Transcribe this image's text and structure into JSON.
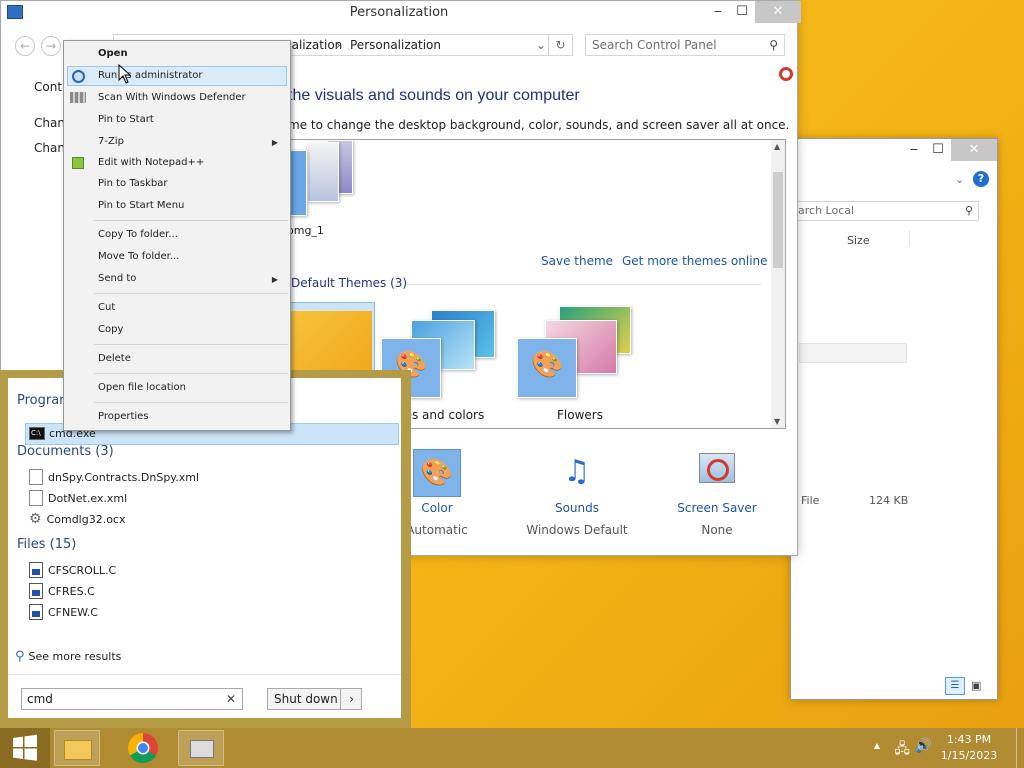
{
  "personalization": {
    "title": "Personalization",
    "breadcrumb_partial": "nalization",
    "breadcrumb_current": "Personalization",
    "search_placeholder": "Search Control Panel",
    "heading": "the visuals and sounds on your computer",
    "subheading": "me to change the desktop background, color, sounds, and screen saver all at once.",
    "left_links": [
      "Contr",
      "Chang",
      "Chang"
    ],
    "theme_label_1": "omg_1",
    "save_theme": "Save theme",
    "get_more": "Get more themes online",
    "default_themes": "Default Themes (3)",
    "theme_lines_colors": "nes and colors",
    "theme_flowers": "Flowers",
    "color_label": "Color",
    "color_sub": "Automatic",
    "sounds_label": "Sounds",
    "sounds_sub": "Windows Default",
    "saver_label": "Screen Saver",
    "saver_sub": "None"
  },
  "explorer": {
    "search_partial": "arch Local",
    "col_size": "Size",
    "row_type_partial": "File",
    "row_size": "124 KB"
  },
  "context_menu": {
    "items": [
      "Open",
      "Run as administrator",
      "Scan With Windows Defender",
      "Pin to Start",
      "7-Zip",
      "Edit with Notepad++",
      "Pin to Taskbar",
      "Pin to Start Menu",
      "Copy To folder...",
      "Move To folder...",
      "Send to",
      "Cut",
      "Copy",
      "Delete",
      "Open file location",
      "Properties"
    ],
    "visible_run_label": "Run as administrator"
  },
  "start_search": {
    "programs_title": "Program",
    "program_item_partial": "cmd.exe",
    "documents_title": "Documents (3)",
    "documents": [
      "dnSpy.Contracts.DnSpy.xml",
      "DotNet.ex.xml",
      "Comdlg32.ocx"
    ],
    "files_title": "Files (15)",
    "files": [
      "CFSCROLL.C",
      "CFRES.C",
      "CFNEW.C"
    ],
    "see_more": "See more results",
    "query": "cmd",
    "shutdown_label": "Shut down"
  },
  "taskbar": {
    "time": "1:43 PM",
    "date": "1/15/2023"
  },
  "colors": {
    "desktop": "#f5b516",
    "taskbar": "#b08b32",
    "start_frame": "#b69b47",
    "link_blue": "#1e55a8",
    "heading_blue": "#1e3287"
  }
}
